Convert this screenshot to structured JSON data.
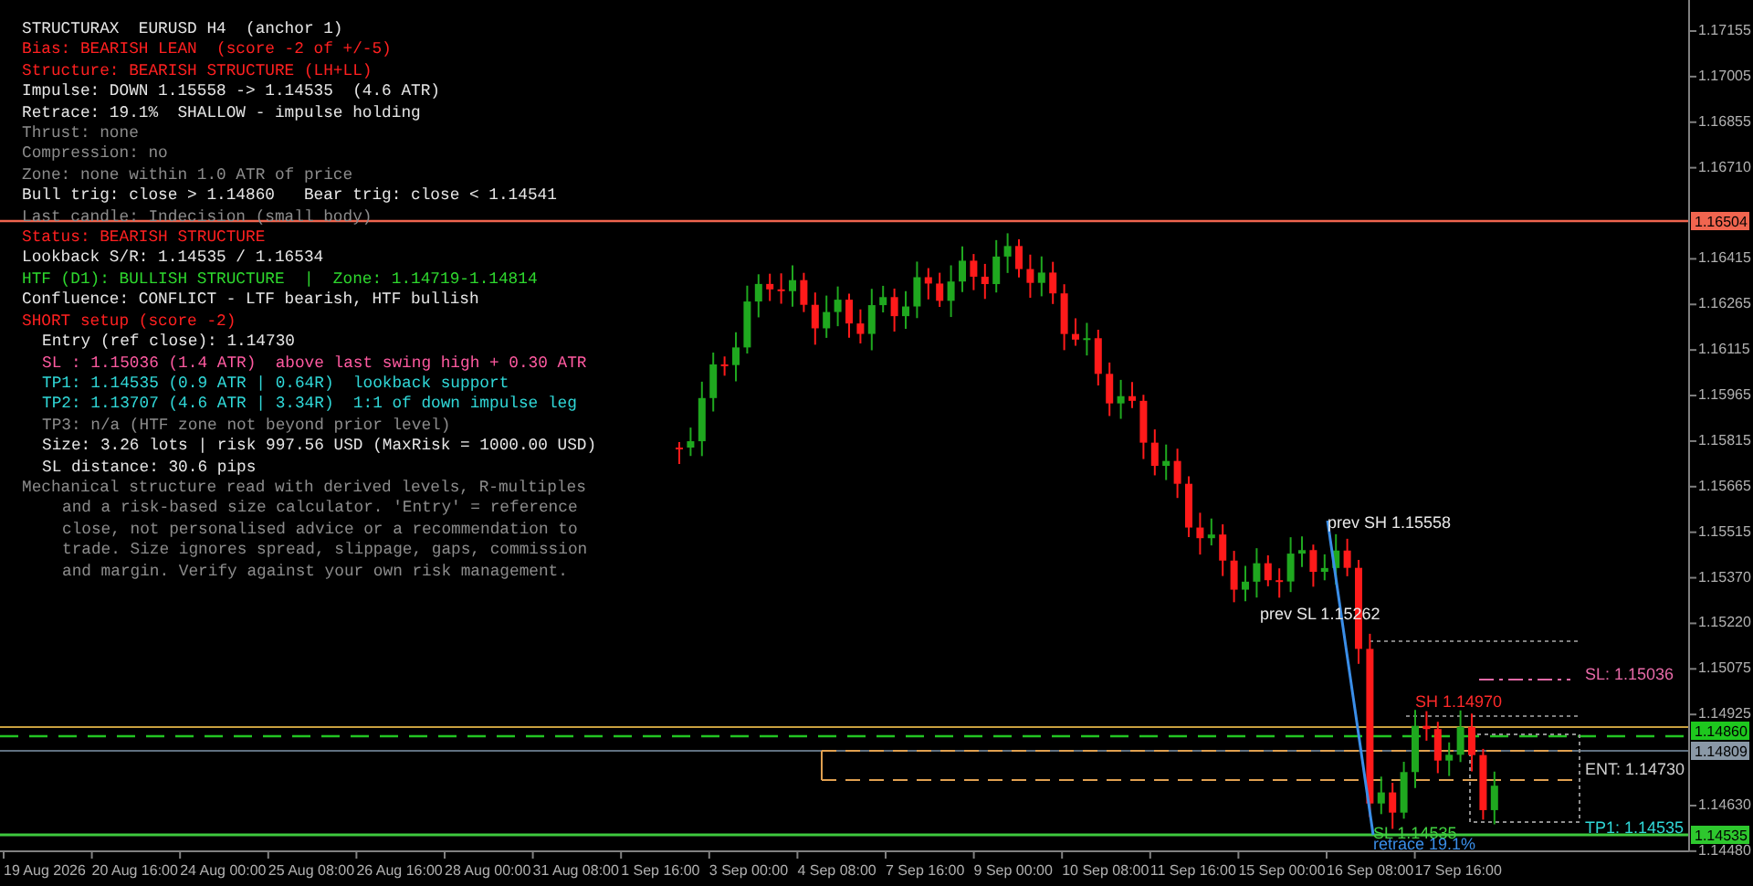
{
  "info_panel": {
    "lines": [
      {
        "text": "STRUCTURAX  EURUSD H4  (anchor 1)",
        "color": "#e6e6e6"
      },
      {
        "text": "Bias: BEARISH LEAN  (score -2 of +/-5)",
        "color": "#ff2020"
      },
      {
        "text": "Structure: BEARISH STRUCTURE (LH+LL)",
        "color": "#ff2020"
      },
      {
        "text": "Impulse: DOWN 1.15558 -> 1.14535  (4.6 ATR)",
        "color": "#e6e6e6"
      },
      {
        "text": "Retrace: 19.1%  SHALLOW - impulse holding",
        "color": "#e6e6e6"
      },
      {
        "text": "Thrust: none",
        "color": "#8c8c8c"
      },
      {
        "text": "Compression: no",
        "color": "#8c8c8c"
      },
      {
        "text": "Zone: none within 1.0 ATR of price",
        "color": "#8c8c8c"
      },
      {
        "text": "Bull trig: close > 1.14860   Bear trig: close < 1.14541",
        "color": "#e6e6e6"
      },
      {
        "text": "Last candle: Indecision (small body)",
        "color": "#8c8c8c"
      },
      {
        "text": "Status: BEARISH STRUCTURE",
        "color": "#ff2020"
      },
      {
        "text": "Lookback S/R: 1.14535 / 1.16534",
        "color": "#e6e6e6"
      },
      {
        "text": "HTF (D1): BULLISH STRUCTURE  |  Zone: 1.14719-1.14814",
        "color": "#2ed82e"
      },
      {
        "text": "Confluence: CONFLICT - LTF bearish, HTF bullish",
        "color": "#e6e6e6"
      }
    ],
    "setup": {
      "title": "SHORT setup (score -2)",
      "color": "#ff2020",
      "lines": [
        {
          "text": "Entry (ref close): 1.14730",
          "color": "#e6e6e6"
        },
        {
          "text": "SL : 1.15036 (1.4 ATR)  above last swing high + 0.30 ATR",
          "color": "#ff5aa0"
        },
        {
          "text": "TP1: 1.14535 (0.9 ATR | 0.64R)  lookback support",
          "color": "#30d8d8"
        },
        {
          "text": "TP2: 1.13707 (4.6 ATR | 3.34R)  1:1 of down impulse leg",
          "color": "#30d8d8"
        },
        {
          "text": "TP3: n/a (HTF zone not beyond prior level)",
          "color": "#8c8c8c"
        },
        {
          "text": "Size: 3.26 lots | risk 997.56 USD (MaxRisk = 1000.00 USD)",
          "color": "#e6e6e6"
        },
        {
          "text": "SL distance: 30.6 pips",
          "color": "#e6e6e6"
        }
      ]
    },
    "disclaimer": "Mechanical structure read with derived levels, R-multiples and a risk-based size calculator. 'Entry' = reference close, not personalised advice or a recommendation to trade. Size ignores spread, slippage, gaps, commission and margin. Verify against your own risk management."
  },
  "chart_labels": [
    {
      "text": "prev SH 1.15558",
      "color": "#e8e8e8"
    },
    {
      "text": "prev SL 1.15262",
      "color": "#e8e8e8"
    },
    {
      "text": "SH 1.14970",
      "color": "#ff2a2a"
    },
    {
      "text": "SL: 1.15036",
      "color": "#e86aa8"
    },
    {
      "text": "ENT: 1.14730",
      "color": "#cfcfcf"
    },
    {
      "text": "TP1: 1.14535",
      "color": "#30d8d8"
    },
    {
      "text": "SL 1.14535",
      "color": "#40d040"
    },
    {
      "text": "retrace 19.1%",
      "color": "#3a8ee8"
    }
  ],
  "price_axis": {
    "ticks": [
      "1.17155",
      "1.17005",
      "1.16855",
      "1.16710",
      "1.16415",
      "1.16265",
      "1.16115",
      "1.15965",
      "1.15815",
      "1.15665",
      "1.15515",
      "1.15370",
      "1.15220",
      "1.15075",
      "1.14925",
      "1.14630",
      "1.14480"
    ],
    "markers": [
      {
        "label": "1.16504",
        "color": "#f0654f"
      },
      {
        "label": "1.14860",
        "color": "#1ec81e"
      },
      {
        "label": "1.14809",
        "color": "#8a98a6"
      },
      {
        "label": "1.14535",
        "color": "#2ec82e"
      }
    ]
  },
  "time_axis": {
    "labels": [
      "19 Aug 2026",
      "20 Aug 16:00",
      "24 Aug 00:00",
      "25 Aug 08:00",
      "26 Aug 16:00",
      "28 Aug 00:00",
      "31 Aug 08:00",
      "1 Sep 16:00",
      "3 Sep 00:00",
      "4 Sep 08:00",
      "7 Sep 16:00",
      "9 Sep 00:00",
      "10 Sep 08:00",
      "11 Sep 16:00",
      "15 Sep 00:00",
      "16 Sep 08:00",
      "17 Sep 16:00"
    ]
  }
}
